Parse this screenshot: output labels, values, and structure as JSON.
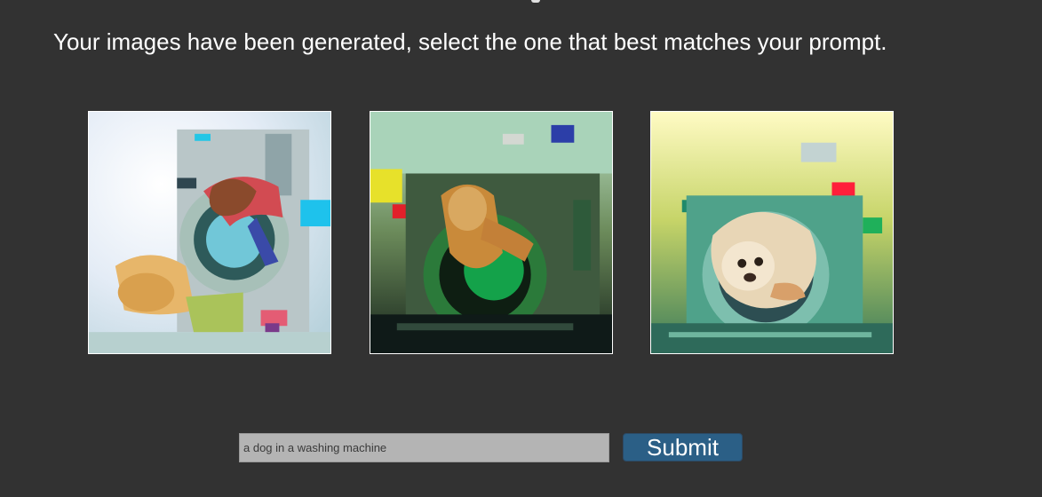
{
  "headline": "Your images have been generated, select the one that best matches your prompt.",
  "images": [
    {
      "name": "generated-image-1",
      "description_icon": "dog-washing-machine-image"
    },
    {
      "name": "generated-image-2",
      "description_icon": "dog-washing-machine-image"
    },
    {
      "name": "generated-image-3",
      "description_icon": "dog-washing-machine-image"
    }
  ],
  "prompt": {
    "value": "a dog in a washing machine"
  },
  "submit": {
    "label": "Submit"
  },
  "colors": {
    "background": "#323232",
    "button": "#2b5f86",
    "input": "#b4b4b4"
  }
}
